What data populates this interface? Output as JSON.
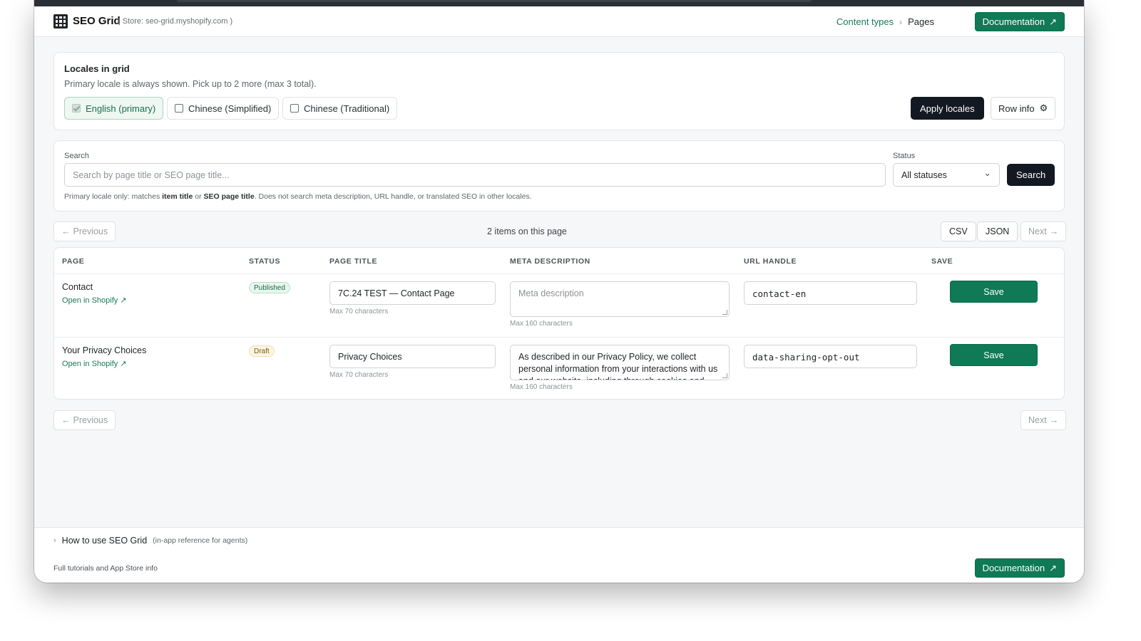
{
  "header": {
    "app_name": "SEO Grid",
    "store": "( Store: seo-grid.myshopify.com )",
    "breadcrumb": {
      "parent": "Content types",
      "current": "Pages"
    },
    "doc_button": "Documentation",
    "doc_arrow": "↗"
  },
  "locales": {
    "title": "Locales in grid",
    "subtitle": "Primary locale is always shown. Pick up to 2 more (max 3 total).",
    "options": [
      {
        "label": "English (primary)",
        "checked": true,
        "disabled": true
      },
      {
        "label": "Chinese (Simplified)",
        "checked": false
      },
      {
        "label": "Chinese (Traditional)",
        "checked": false
      }
    ],
    "apply_button": "Apply locales",
    "row_info_button": "Row info",
    "gear": "⚙"
  },
  "search": {
    "label": "Search",
    "placeholder": "Search by page title or SEO page title...",
    "status_label": "Status",
    "status_value": "All statuses",
    "chevron": "⌄",
    "button": "Search",
    "hint_pre": "Primary locale only: matches ",
    "hint_b1": "item title",
    "hint_mid": " or ",
    "hint_b2": "SEO page title",
    "hint_post": ". Does not search meta description, URL handle, or translated SEO in other locales."
  },
  "pagination": {
    "previous": "Previous",
    "next": "Next",
    "left_arrow": "←",
    "right_arrow": "→",
    "count": "2 items on this page",
    "csv": "CSV",
    "json": "JSON"
  },
  "table": {
    "columns": [
      "PAGE",
      "STATUS",
      "PAGE TITLE",
      "META DESCRIPTION",
      "URL HANDLE",
      "SAVE"
    ],
    "rows": [
      {
        "page": "Contact",
        "link": "Open in Shopify ↗",
        "status": "Published",
        "title": "7C.24 TEST — Contact Page",
        "title_hint": "Max 70 characters",
        "meta": "",
        "meta_placeholder": "Meta description",
        "meta_hint": "Max 160 characters",
        "handle": "contact-en",
        "save": "Save"
      },
      {
        "page": "Your Privacy Choices",
        "link": "Open in Shopify ↗",
        "status": "Draft",
        "title": "Privacy Choices",
        "title_hint": "Max 70 characters",
        "meta": "As described in our Privacy Policy, we collect personal information from your interactions with us and our website, including through cookies and",
        "meta_placeholder": "",
        "meta_hint": "Max 160 characters",
        "handle": "data-sharing-opt-out",
        "save": "Save"
      }
    ]
  },
  "footer": {
    "chevron": "›",
    "howto": "How to use SEO Grid",
    "howto_note": "(in-app reference for agents)",
    "tutorials": "Full tutorials and App Store info",
    "doc_button": "Documentation",
    "doc_arrow": "↗"
  },
  "colors": {
    "accent": "#0f7a55",
    "dark_button": "#131922",
    "published_badge": "#e8f6ee",
    "draft_badge": "#fdf5e4"
  }
}
